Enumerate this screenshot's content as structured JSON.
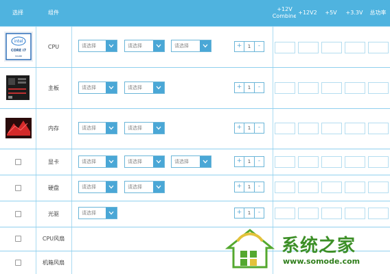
{
  "header": {
    "select": "选择",
    "component": "组件",
    "p12v_combine": "+12V Combine",
    "p12v2": "+12V2",
    "p5v": "+5V",
    "p33v": "+3.3V",
    "total": "总功率"
  },
  "placeholder": "请选择",
  "rows": [
    {
      "name": "CPU"
    },
    {
      "name": "主板"
    },
    {
      "name": "内存"
    },
    {
      "name": "显卡"
    },
    {
      "name": "硬盘"
    },
    {
      "name": "光驱"
    },
    {
      "name": "CPU风扇"
    },
    {
      "name": "机箱风扇"
    }
  ],
  "stepper": {
    "plus": "+",
    "minus": "-",
    "value": "1"
  },
  "cpu_badge": {
    "brand": "intel",
    "line": "CORE i7",
    "tag": "inside"
  },
  "watermark": {
    "title": "系统之家",
    "url": "www.somode.com"
  },
  "colors": {
    "header": "#4fb3df",
    "accent": "#4aa7d6",
    "watermark": "#3d8f27"
  }
}
